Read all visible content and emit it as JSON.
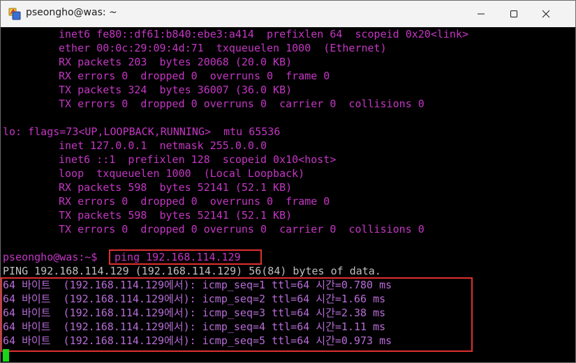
{
  "window": {
    "title": "pseongho@was: ~"
  },
  "terminal": {
    "lines_top": [
      "inet6 fe80::df61:b840:ebe3:a414  prefixlen 64  scopeid 0x20<link>",
      "ether 00:0c:29:09:4d:71  txqueuelen 1000  (Ethernet)",
      "RX packets 203  bytes 20068 (20.0 KB)",
      "RX errors 0  dropped 0  overruns 0  frame 0",
      "TX packets 324  bytes 36007 (36.0 KB)",
      "TX errors 0  dropped 0 overruns 0  carrier 0  collisions 0"
    ],
    "lo_header": "lo: flags=73<UP,LOOPBACK,RUNNING>  mtu 65536",
    "lines_lo": [
      "inet 127.0.0.1  netmask 255.0.0.0",
      "inet6 ::1  prefixlen 128  scopeid 0x10<host>",
      "loop  txqueuelen 1000  (Local Loopback)",
      "RX packets 598  bytes 52141 (52.1 KB)",
      "RX errors 0  dropped 0  overruns 0  frame 0",
      "TX packets 598  bytes 52141 (52.1 KB)",
      "TX errors 0  dropped 0 overruns 0  carrier 0  collisions 0"
    ],
    "prompt": "pseongho@was:~$",
    "command": "ping 192.168.114.129",
    "ping_header": "PING 192.168.114.129 (192.168.114.129) 56(84) bytes of data.",
    "replies": [
      "64 바이트  (192.168.114.129에서): icmp_seq=1 ttl=64 시간=0.780 ms",
      "64 바이트  (192.168.114.129에서): icmp_seq=2 ttl=64 시간=1.66 ms",
      "64 바이트  (192.168.114.129에서): icmp_seq=3 ttl=64 시간=2.38 ms",
      "64 바이트  (192.168.114.129에서): icmp_seq=4 ttl=64 시간=1.11 ms",
      "64 바이트  (192.168.114.129에서): icmp_seq=5 ttl=64 시간=0.973 ms"
    ]
  },
  "colors": {
    "text": "#c436c4",
    "highlight_box": "#e03030",
    "cursor": "#19d619"
  },
  "icons": {
    "app": "terminal-app-icon",
    "minimize": "minimize-icon",
    "maximize": "maximize-icon",
    "close": "close-icon"
  }
}
